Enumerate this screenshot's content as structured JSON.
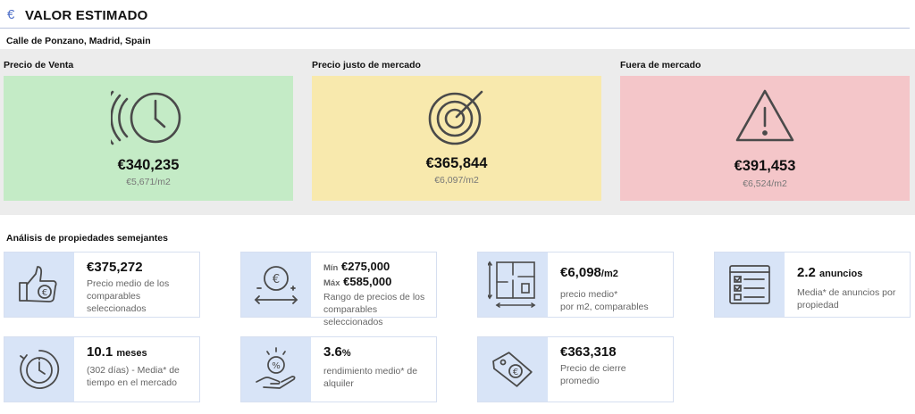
{
  "header": {
    "euro_glyph": "€",
    "title": "VALOR ESTIMADO",
    "address": "Calle de Ponzano, Madrid, Spain"
  },
  "price_columns": [
    {
      "label": "Precio de Venta",
      "value": "€340,235",
      "per_m2": "€5,671/m2",
      "icon": "clock-icon",
      "color": "#c4ebc6"
    },
    {
      "label": "Precio justo de mercado",
      "value": "€365,844",
      "per_m2": "€6,097/m2",
      "icon": "target-icon",
      "color": "#f8e9ad"
    },
    {
      "label": "Fuera de mercado",
      "value": "€391,453",
      "per_m2": "€6,524/m2",
      "icon": "warning-icon",
      "color": "#f4c6c9"
    }
  ],
  "analysis": {
    "label": "Análisis de propiedades semejantes",
    "stats": [
      {
        "icon": "thumbs-up-euro-icon",
        "value": "€375,272",
        "desc": "Precio medio de los comparables seleccionados"
      },
      {
        "icon": "coin-range-icon",
        "min_label": "Mín",
        "min_value": "€275,000",
        "max_label": "Máx",
        "max_value": "€585,000",
        "desc": "Rango de precios de los comparables seleccionados"
      },
      {
        "icon": "floor-plan-icon",
        "value": "€6,098",
        "unit": "/m2",
        "desc_line1": "precio medio*",
        "desc_line2": "por m2, comparables"
      },
      {
        "icon": "listing-icon",
        "value": "2.2",
        "unit": "anuncios",
        "desc": "Media* de anuncios por propiedad"
      },
      {
        "icon": "stopwatch-icon",
        "value": "10.1",
        "unit": "meses",
        "desc": "(302 días) - Media* de tiempo en el mercado"
      },
      {
        "icon": "hand-percent-icon",
        "value": "3.6",
        "unit": "%",
        "desc": "rendimiento medio* de alquiler"
      },
      {
        "icon": "price-tag-icon",
        "value": "€363,318",
        "desc": "Precio de cierre promedio"
      }
    ]
  },
  "colors": {
    "accent": "#4f6fc7",
    "icon_bg": "#d8e4f7",
    "icon_stroke": "#4a4a4a"
  }
}
